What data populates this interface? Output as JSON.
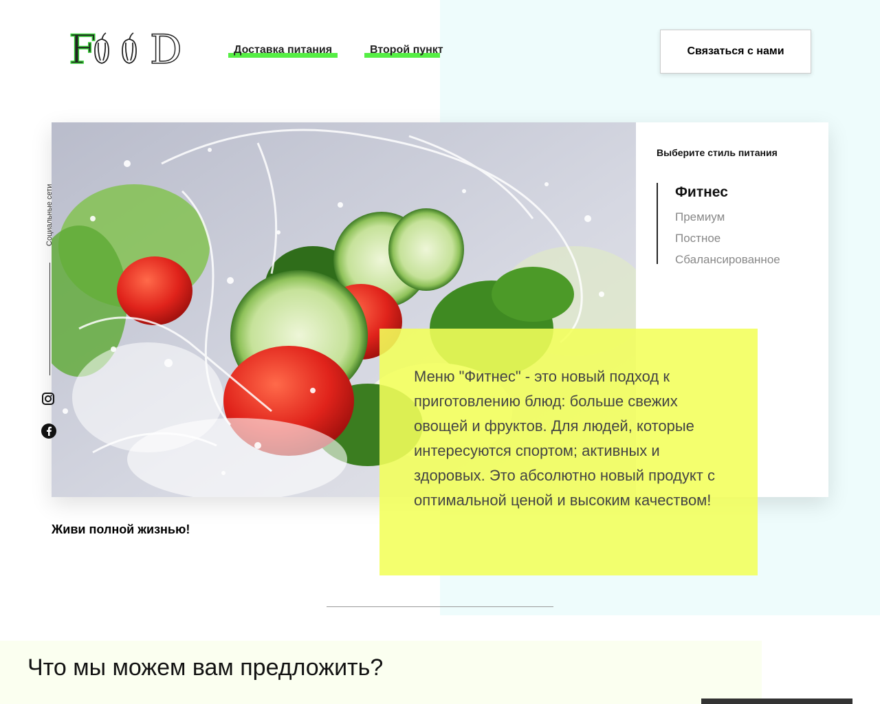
{
  "header": {
    "logo_text": "FOOD",
    "nav": [
      {
        "label": "Доставка питания"
      },
      {
        "label": "Второй пункт"
      }
    ],
    "contact_button": "Связаться с нами"
  },
  "colors": {
    "nav_underline": "#55ee44",
    "description_box": "#f3ff5a",
    "right_background": "#eefcfc"
  },
  "hero": {
    "image": "salad-with-water-splash",
    "social": {
      "label": "Социальные сети",
      "icons": [
        "instagram-icon",
        "facebook-icon"
      ]
    },
    "style_selector": {
      "title": "Выберите стиль питания",
      "items": [
        "Фитнес",
        "Премиум",
        "Постное",
        "Сбалансированное"
      ],
      "active": "Фитнес"
    },
    "description": "Меню \"Фитнес\" - это новый подход к приготовлению блюд: больше свежих овощей и фруктов. Для людей, которые интересуются спортом; активных и здоровых. Это абсолютно новый продукт с оптимальной ценой и высоким качеством!",
    "slogan": "Живи полной жизнью!"
  },
  "offer": {
    "title": "Что мы можем вам предложить?"
  }
}
